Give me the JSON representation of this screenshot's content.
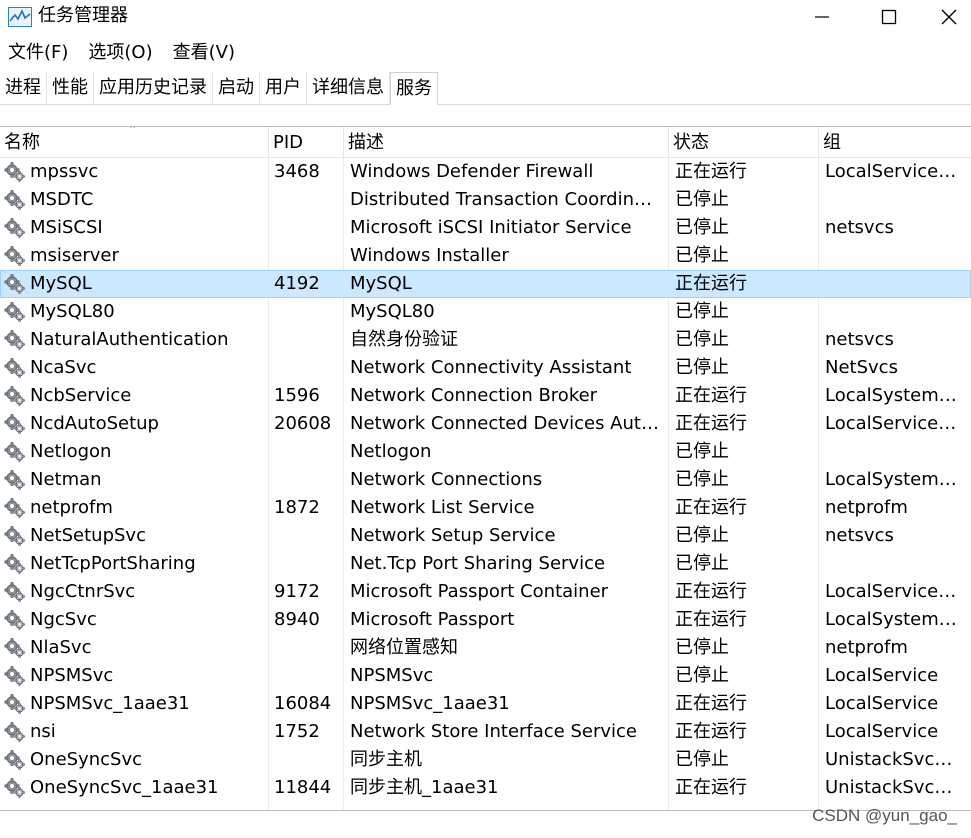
{
  "window": {
    "title": "任务管理器",
    "controls": [
      "minimize-icon",
      "maximize-icon",
      "close-icon"
    ]
  },
  "menu": [
    "文件(F)",
    "选项(O)",
    "查看(V)"
  ],
  "tabs": [
    {
      "label": "进程",
      "active": false
    },
    {
      "label": "性能",
      "active": false
    },
    {
      "label": "应用历史记录",
      "active": false
    },
    {
      "label": "启动",
      "active": false
    },
    {
      "label": "用户",
      "active": false
    },
    {
      "label": "详细信息",
      "active": false
    },
    {
      "label": "服务",
      "active": true
    }
  ],
  "columns": {
    "name": "名称",
    "pid": "PID",
    "desc": "描述",
    "status": "状态",
    "group": "组"
  },
  "sort": {
    "column": "name",
    "icon": "sort-ascending-icon"
  },
  "selected_row": 4,
  "rows": [
    {
      "name": "mpssvc",
      "pid": "3468",
      "desc": "Windows Defender Firewall",
      "status": "正在运行",
      "group": "LocalServiceN..."
    },
    {
      "name": "MSDTC",
      "pid": "",
      "desc": "Distributed Transaction Coordinator",
      "status": "已停止",
      "group": ""
    },
    {
      "name": "MSiSCSI",
      "pid": "",
      "desc": "Microsoft iSCSI Initiator Service",
      "status": "已停止",
      "group": "netsvcs"
    },
    {
      "name": "msiserver",
      "pid": "",
      "desc": "Windows Installer",
      "status": "已停止",
      "group": ""
    },
    {
      "name": "MySQL",
      "pid": "4192",
      "desc": "MySQL",
      "status": "正在运行",
      "group": ""
    },
    {
      "name": "MySQL80",
      "pid": "",
      "desc": "MySQL80",
      "status": "已停止",
      "group": ""
    },
    {
      "name": "NaturalAuthentication",
      "pid": "",
      "desc": "自然身份验证",
      "status": "已停止",
      "group": "netsvcs"
    },
    {
      "name": "NcaSvc",
      "pid": "",
      "desc": "Network Connectivity Assistant",
      "status": "已停止",
      "group": "NetSvcs"
    },
    {
      "name": "NcbService",
      "pid": "1596",
      "desc": "Network Connection Broker",
      "status": "正在运行",
      "group": "LocalSystemN..."
    },
    {
      "name": "NcdAutoSetup",
      "pid": "20608",
      "desc": "Network Connected Devices Auto-...",
      "status": "正在运行",
      "group": "LocalServiceN..."
    },
    {
      "name": "Netlogon",
      "pid": "",
      "desc": "Netlogon",
      "status": "已停止",
      "group": ""
    },
    {
      "name": "Netman",
      "pid": "",
      "desc": "Network Connections",
      "status": "已停止",
      "group": "LocalSystemN..."
    },
    {
      "name": "netprofm",
      "pid": "1872",
      "desc": "Network List Service",
      "status": "正在运行",
      "group": "netprofm"
    },
    {
      "name": "NetSetupSvc",
      "pid": "",
      "desc": "Network Setup Service",
      "status": "已停止",
      "group": "netsvcs"
    },
    {
      "name": "NetTcpPortSharing",
      "pid": "",
      "desc": "Net.Tcp Port Sharing Service",
      "status": "已停止",
      "group": ""
    },
    {
      "name": "NgcCtnrSvc",
      "pid": "9172",
      "desc": "Microsoft Passport Container",
      "status": "正在运行",
      "group": "LocalServiceN..."
    },
    {
      "name": "NgcSvc",
      "pid": "8940",
      "desc": "Microsoft Passport",
      "status": "正在运行",
      "group": "LocalSystemN..."
    },
    {
      "name": "NlaSvc",
      "pid": "",
      "desc": "网络位置感知",
      "status": "已停止",
      "group": "netprofm"
    },
    {
      "name": "NPSMSvc",
      "pid": "",
      "desc": "NPSMSvc",
      "status": "已停止",
      "group": "LocalService"
    },
    {
      "name": "NPSMSvc_1aae31",
      "pid": "16084",
      "desc": "NPSMSvc_1aae31",
      "status": "正在运行",
      "group": "LocalService"
    },
    {
      "name": "nsi",
      "pid": "1752",
      "desc": "Network Store Interface Service",
      "status": "正在运行",
      "group": "LocalService"
    },
    {
      "name": "OneSyncSvc",
      "pid": "",
      "desc": "同步主机",
      "status": "已停止",
      "group": "UnistackSvcGr..."
    },
    {
      "name": "OneSyncSvc_1aae31",
      "pid": "11844",
      "desc": "同步主机_1aae31",
      "status": "正在运行",
      "group": "UnistackSvcGr..."
    }
  ],
  "row_icon": "service-gear-icon",
  "watermark": "CSDN @yun_gao_"
}
